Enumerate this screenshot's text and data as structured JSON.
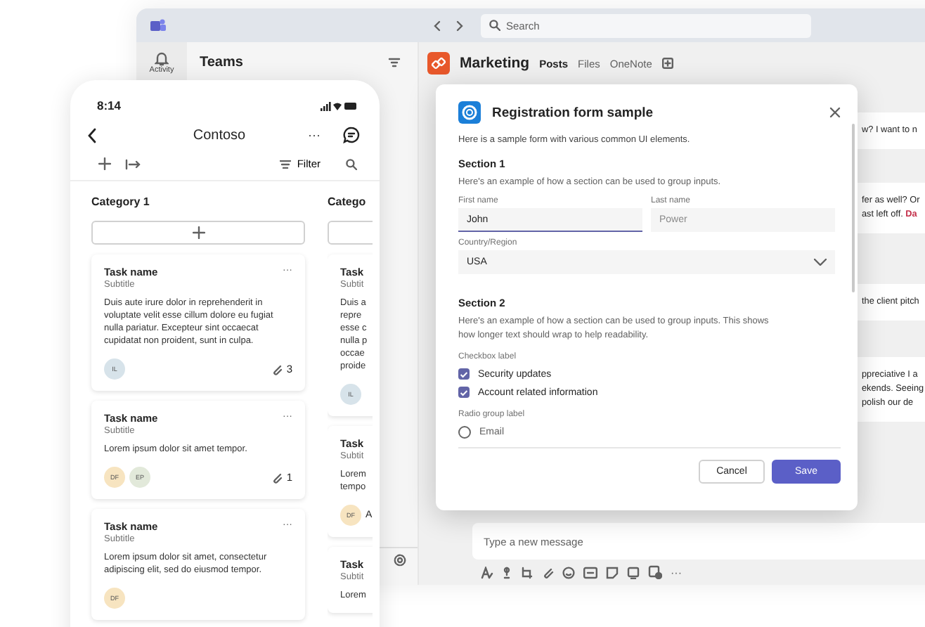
{
  "teams_window": {
    "search": {
      "placeholder": "Search"
    },
    "rail": [
      {
        "label": "Activity"
      }
    ],
    "panel_title": "Teams",
    "channel": {
      "name": "Marketing",
      "tabs": [
        {
          "label": "Posts",
          "selected": true
        },
        {
          "label": "Files",
          "selected": false
        },
        {
          "label": "OneNote",
          "selected": false
        }
      ]
    },
    "messages": [
      {
        "lines": [
          [
            {
              "text": "w? I want to n"
            }
          ]
        ]
      },
      {
        "lines": [
          [
            {
              "text": "fer as well? Or"
            }
          ],
          [
            {
              "text": "ast left off. "
            },
            {
              "text": "Da",
              "kind": "mention"
            }
          ]
        ]
      },
      {
        "lines": [
          [
            {
              "text": "the client pitch"
            }
          ]
        ]
      },
      {
        "lines": [
          [
            {
              "text": "ppreciative I a"
            }
          ],
          [
            {
              "text": "ekends. Seeing"
            }
          ],
          [
            {
              "text": "polish our de"
            }
          ]
        ]
      }
    ],
    "compose": {
      "placeholder": "Type a new message",
      "more": "···"
    }
  },
  "phone": {
    "time": "8:14",
    "title": "Contoso",
    "more": "···",
    "filter": "Filter",
    "columns": [
      {
        "title": "Category 1",
        "cards": [
          {
            "title": "Task name",
            "subtitle": "Subtitle",
            "body": [
              "Duis aute irure dolor in reprehenderit in",
              "voluptate velit esse cillum dolore eu fugiat",
              "nulla pariatur. Excepteur sint occaecat",
              "cupidatat non proident, sunt in culpa."
            ],
            "more": "···",
            "avatars": [
              {
                "initials": "IL",
                "color": "#d7e3ea"
              }
            ],
            "attachments": "3"
          },
          {
            "title": "Task name",
            "subtitle": "Subtitle",
            "body": [
              "Lorem ipsum dolor sit amet tempor."
            ],
            "more": "···",
            "avatars": [
              {
                "initials": "DF",
                "color": "#f7e4c0"
              },
              {
                "initials": "EP",
                "color": "#e2e9da"
              }
            ],
            "attachments": "1"
          },
          {
            "title": "Task name",
            "subtitle": "Subtitle",
            "body": [
              "Lorem ipsum dolor sit amet, consectetur",
              "adipiscing elit, sed do eiusmod tempor."
            ],
            "more": "···",
            "avatars": [
              {
                "initials": "DF",
                "color": "#f7e4c0"
              }
            ]
          }
        ]
      },
      {
        "title": "Catego",
        "cards": [
          {
            "title": "Task",
            "subtitle": "Subtit",
            "body": [
              "Duis a",
              "repre",
              "esse c",
              "nulla p",
              "occae",
              "proide"
            ],
            "avatars": [
              {
                "initials": "IL",
                "color": "#d7e3ea"
              }
            ]
          },
          {
            "title": "Task",
            "subtitle": "Subtit",
            "body": [
              "Lorem",
              "tempo"
            ],
            "avatars": [
              {
                "initials": "DF",
                "color": "#f7e4c0"
              }
            ],
            "owner": "A"
          },
          {
            "title": "Task",
            "subtitle": "Subtit",
            "body": [
              "Lorem"
            ]
          }
        ]
      }
    ]
  },
  "dialog": {
    "title": "Registration form sample",
    "intro": "Here is a sample form with various common UI elements.",
    "sections": [
      {
        "title": "Section 1",
        "description": "Here's an example of how a section can be used to group inputs."
      },
      {
        "title": "Section 2",
        "description": "Here's an example of how a section can be used to group inputs. This shows how longer text should wrap to help readability."
      }
    ],
    "first_name": {
      "label": "First name",
      "value": "John",
      "focused": true
    },
    "last_name": {
      "label": "Last name",
      "placeholder": "Power"
    },
    "country": {
      "label": "Country/Region",
      "value": "USA"
    },
    "checkbox_label": "Checkbox label",
    "checkboxes": [
      {
        "label": "Security updates",
        "checked": true
      },
      {
        "label": "Account related information",
        "checked": true
      }
    ],
    "radio_label": "Radio group label",
    "radios": [
      {
        "label": "Email",
        "selected": false
      }
    ],
    "buttons": [
      {
        "label": "Cancel",
        "kind": "secondary"
      },
      {
        "label": "Save",
        "kind": "primary"
      }
    ]
  }
}
